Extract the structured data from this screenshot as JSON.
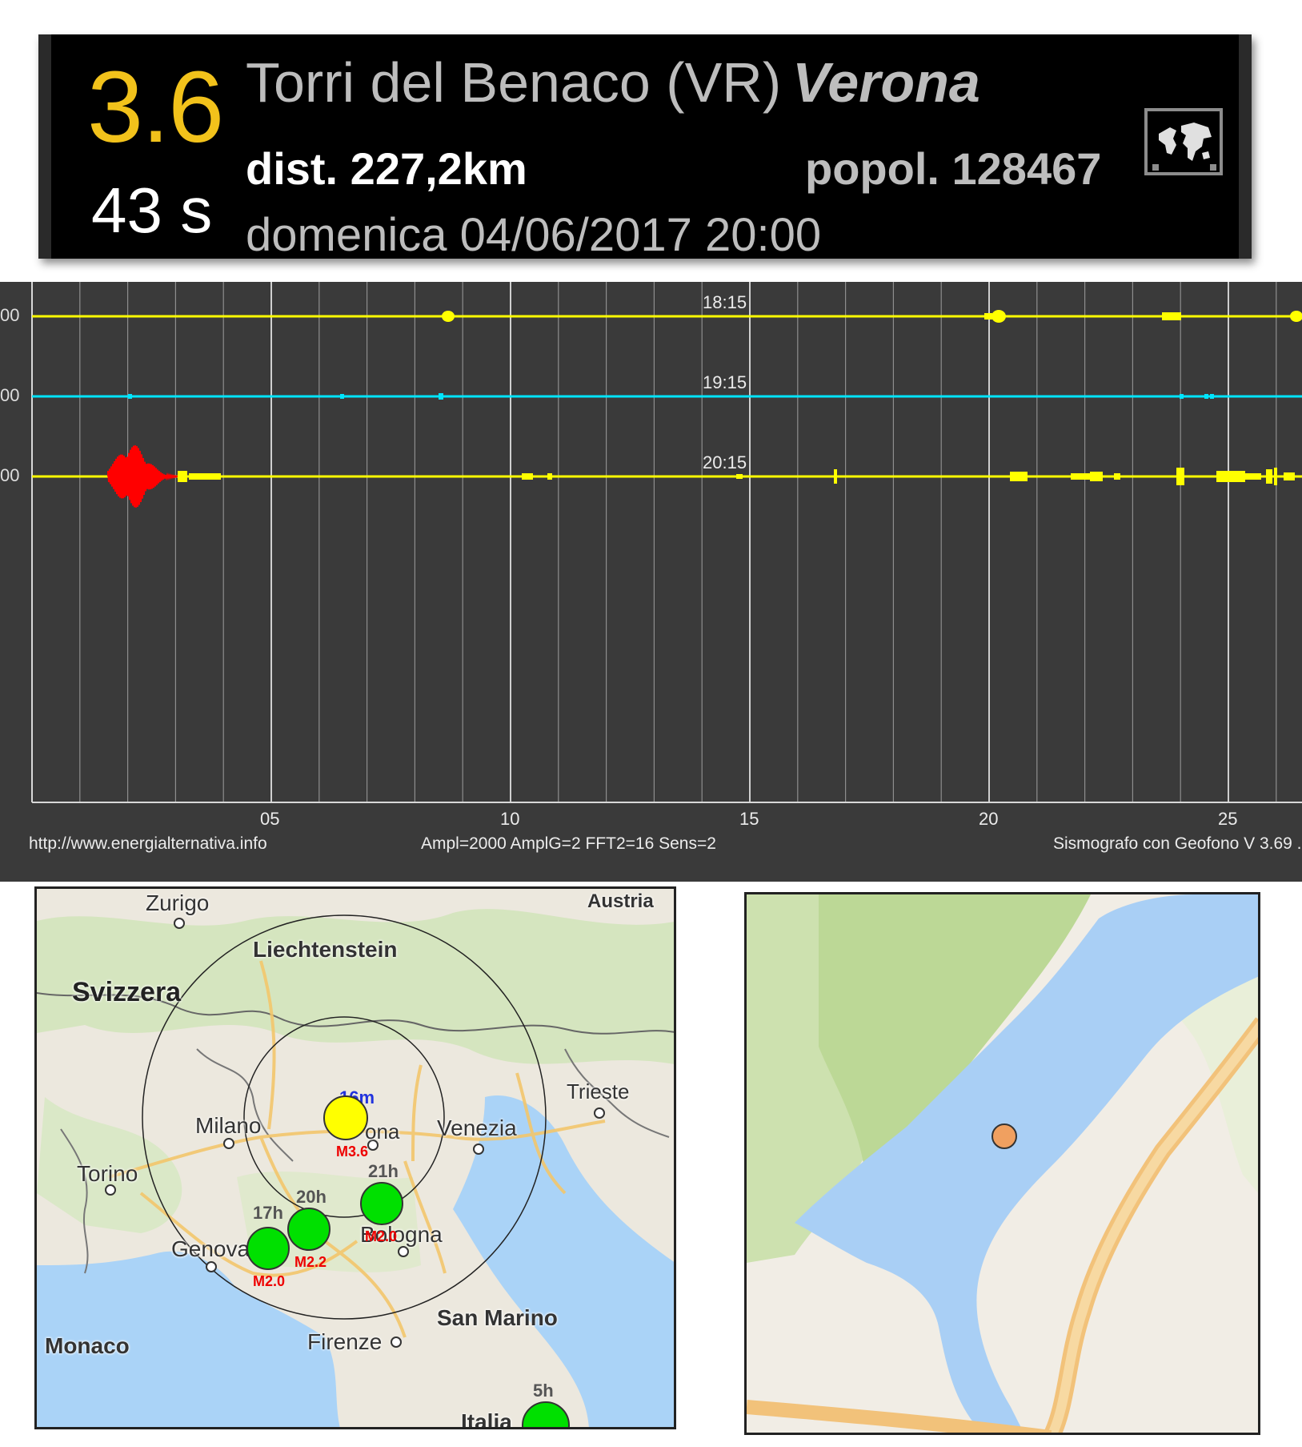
{
  "event": {
    "magnitude": "3.6",
    "delay": "43 s",
    "place": "Torri del Benaco (VR)",
    "region": "Verona",
    "distance": "dist. 227,2km",
    "population": "popol. 128467",
    "datetime": "domenica 04/06/2017 20:00",
    "map_button_icon": "world-map-icon",
    "colors": {
      "magnitude": "#f2c21b",
      "background": "#000000"
    }
  },
  "seismograph": {
    "row_labels": [
      "18:15",
      "19:15",
      "20:15"
    ],
    "left_tick_labels": [
      "00",
      "00",
      "00"
    ],
    "x_ticks": [
      "05",
      "10",
      "15",
      "20",
      "25"
    ],
    "footer_left": "http://www.energialternativa.info",
    "footer_center": "Ampl=2000 AmplG=2 FFT2=16 Sens=2",
    "footer_right": "Sismografo con Geofono V 3.69 .",
    "colors": {
      "trace1": "#ffff00",
      "trace2": "#00e5ff",
      "trace3": "#ffff00",
      "quake": "#ff0000",
      "background": "#3a3a3a"
    }
  },
  "map": {
    "countries": [
      "Svizzera",
      "Liechtenstein",
      "Austria",
      "Monaco",
      "San Marino",
      "Italia"
    ],
    "cities": [
      "Zurigo",
      "Milano",
      "Torino",
      "Genova",
      "Venezia",
      "Trieste",
      "Bologna",
      "Firenze",
      "ona"
    ],
    "events": [
      {
        "time": "16m",
        "mag": "M3.6",
        "color": "#ffff00"
      },
      {
        "time": "21h",
        "mag": "M2.0",
        "color": "#00e000"
      },
      {
        "time": "20h",
        "mag": "M2.2",
        "color": "#00e000"
      },
      {
        "time": "17h",
        "mag": "M2.0",
        "color": "#00e000"
      },
      {
        "time": "5h",
        "mag": "",
        "color": "#00e000"
      }
    ]
  },
  "zoom_map": {
    "marker_color": "#f0a060"
  }
}
